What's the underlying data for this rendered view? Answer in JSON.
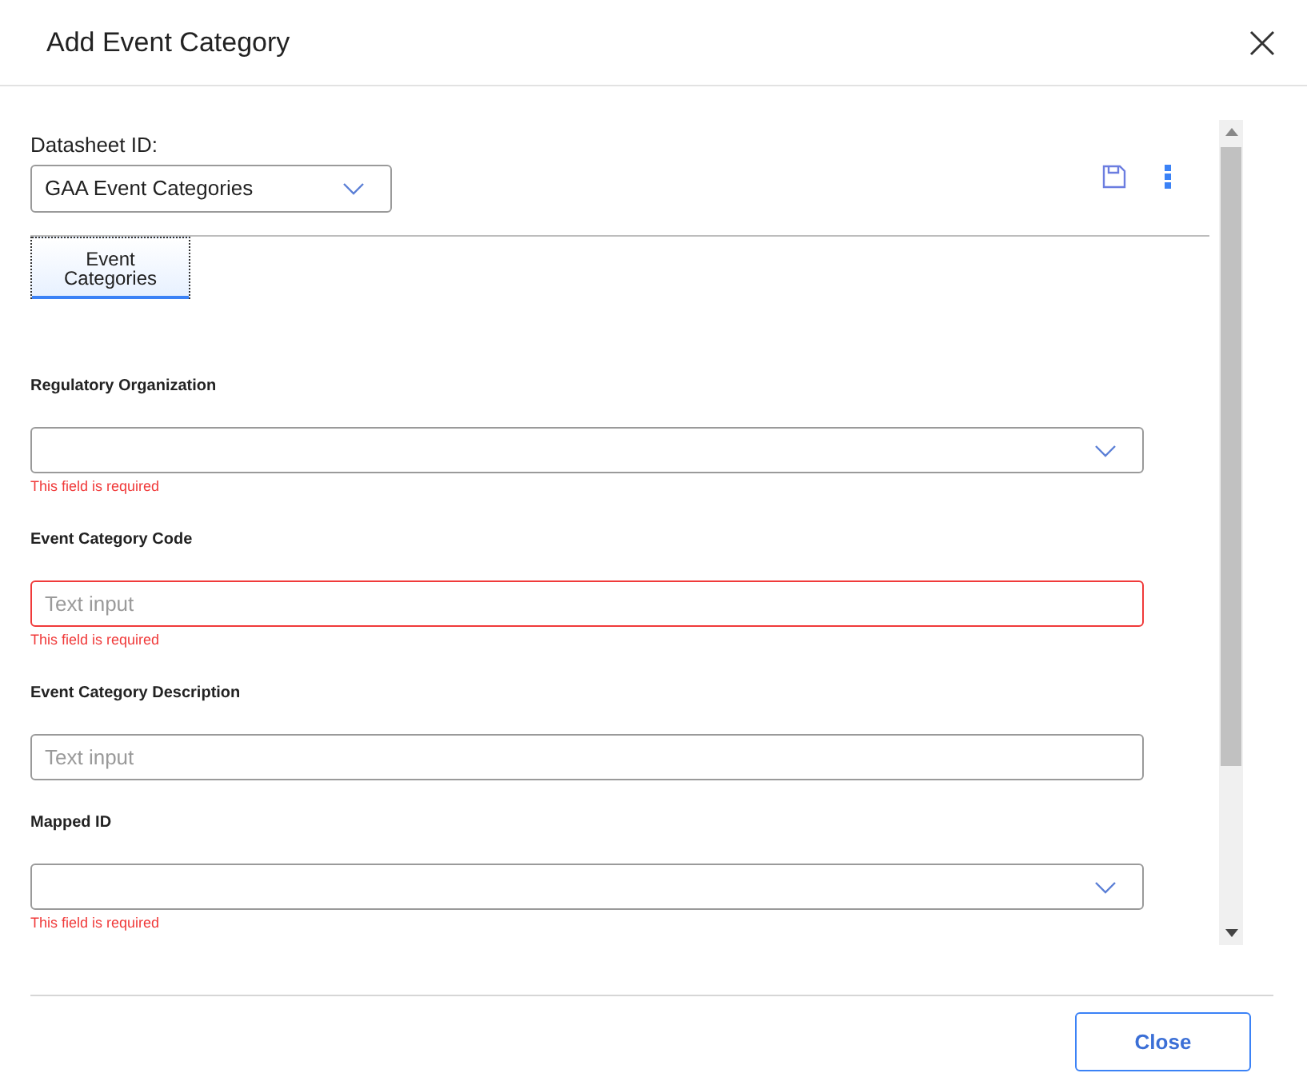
{
  "dialog": {
    "title": "Add Event Category"
  },
  "datasheet": {
    "label": "Datasheet ID:",
    "value": "GAA Event Categories"
  },
  "tabs": [
    {
      "label": "Event Categories",
      "selected": true
    }
  ],
  "fields": [
    {
      "label": "Regulatory Organization",
      "kind": "select",
      "invalid": false,
      "error": "This field is required"
    },
    {
      "label": "Event Category Code",
      "kind": "text",
      "placeholder": "Text input",
      "invalid": true,
      "error": "This field is required"
    },
    {
      "label": "Event Category Description",
      "kind": "text",
      "placeholder": "Text input",
      "invalid": false
    },
    {
      "label": "Mapped ID",
      "kind": "select",
      "invalid": false,
      "error": "This field is required"
    }
  ],
  "footer": {
    "button": "Close"
  }
}
